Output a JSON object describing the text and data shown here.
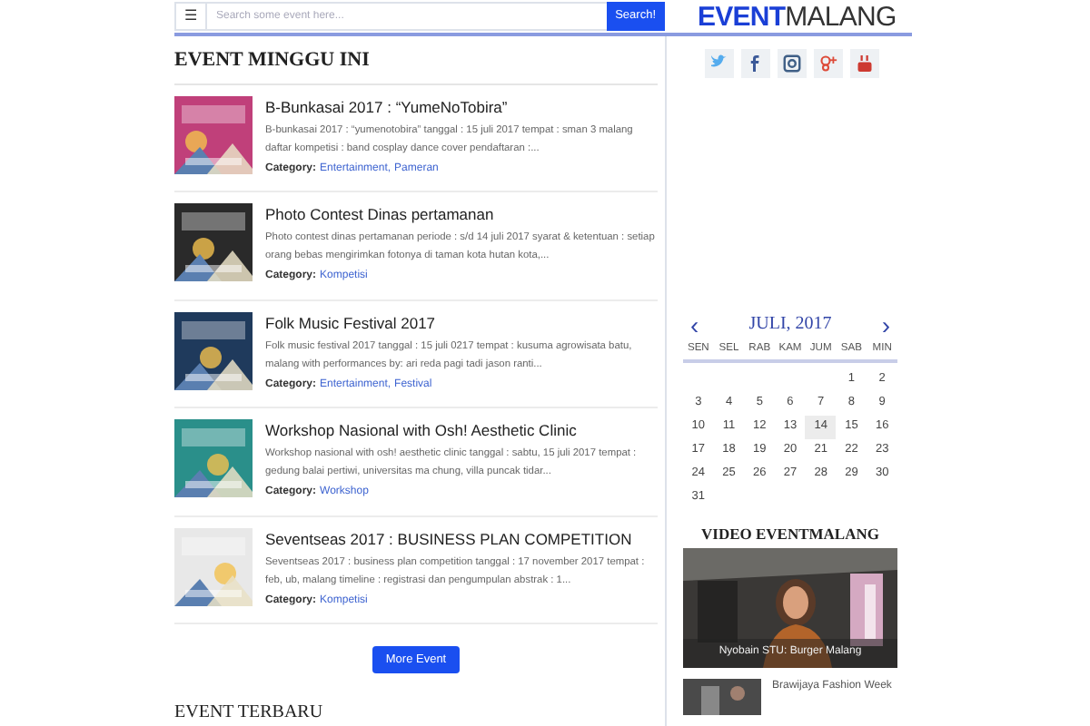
{
  "search": {
    "menu": "☰",
    "placeholder": "Search some event here...",
    "button": "Search!"
  },
  "logo": {
    "bold": "EVENT",
    "light": "MALANG"
  },
  "section_title": "EVENT MINGGU INI",
  "events": [
    {
      "title": "B-Bunkasai 2017 : “YumeNoTobira”",
      "description": "B-bunkasai 2017 : “yumenotobira” tanggal : 15 juli 2017 tempat : sman 3 malang daftar kompetisi : band cosplay dance cover pendaftaran :...",
      "category_label": "Category:",
      "categories": [
        "Entertainment",
        "Pameran"
      ],
      "separator": ","
    },
    {
      "title": "Photo Contest Dinas pertamanan",
      "description": "Photo contest dinas pertamanan periode : s/d 14 juli 2017 syarat & ketentuan : setiap orang bebas mengirimkan fotonya di taman kota hutan kota,...",
      "category_label": "Category:",
      "categories": [
        "Kompetisi"
      ]
    },
    {
      "title": "Folk Music Festival 2017",
      "description": "Folk music festival 2017 tanggal : 15 juli 0217 tempat  : kusuma agrowisata batu, malang   with performances by: ari reda pagi tadi jason ranti...",
      "category_label": "Category:",
      "categories": [
        "Entertainment",
        "Festival"
      ],
      "separator": ","
    },
    {
      "title": "Workshop Nasional with Osh! Aesthetic Clinic",
      "description": "Workshop nasional with osh! aesthetic clinic tanggal : sabtu, 15 juli 2017 tempat : gedung balai pertiwi, universitas ma chung, villa puncak tidar...",
      "category_label": "Category:",
      "categories": [
        "Workshop"
      ]
    },
    {
      "title": "Seventseas 2017 : BUSINESS PLAN COMPETITION",
      "description": "Seventseas 2017 : business plan competition tanggal : 17 november 2017 tempat : feb, ub, malang timeline : registrasi dan pengumpulan abstrak : 1...",
      "category_label": "Category:",
      "categories": [
        "Kompetisi"
      ]
    }
  ],
  "more_button": "More Event",
  "next_section_title": "EVENT TERBARU",
  "calendar": {
    "prev": "‹",
    "month": "JULI, 2017",
    "next": "›",
    "weekdays": [
      "SEN",
      "SEL",
      "RAB",
      "KAM",
      "JUM",
      "SAB",
      "MIN"
    ],
    "weeks": [
      [
        {
          "kind": "blank"
        },
        {
          "kind": "blank"
        },
        {
          "kind": "blank"
        },
        {
          "kind": "blank"
        },
        {
          "kind": "blank"
        },
        {
          "kind": "day",
          "day": "1",
          "selected": false
        },
        {
          "kind": "day",
          "day": "2",
          "selected": false
        }
      ],
      [
        {
          "day": "3",
          "selected": false
        },
        {
          "day": "4",
          "selected": false
        },
        {
          "day": "5",
          "selected": false
        },
        {
          "day": "6",
          "selected": false
        },
        {
          "day": "7",
          "selected": false
        },
        {
          "day": "8",
          "selected": false
        },
        {
          "day": "9",
          "selected": false
        }
      ],
      [
        {
          "day": "10",
          "selected": false
        },
        {
          "day": "11",
          "selected": false
        },
        {
          "day": "12",
          "selected": false
        },
        {
          "day": "13",
          "selected": false
        },
        {
          "day": "14",
          "selected": true
        },
        {
          "day": "15",
          "selected": false
        },
        {
          "day": "16",
          "selected": false
        }
      ],
      [
        {
          "day": "17",
          "selected": false
        },
        {
          "day": "18",
          "selected": false
        },
        {
          "day": "19",
          "selected": false
        },
        {
          "day": "20",
          "selected": false
        },
        {
          "day": "21",
          "selected": false
        },
        {
          "day": "22",
          "selected": false
        },
        {
          "day": "23",
          "selected": false
        }
      ],
      [
        {
          "day": "24",
          "selected": false
        },
        {
          "day": "25",
          "selected": false
        },
        {
          "day": "26",
          "selected": false
        },
        {
          "day": "27",
          "selected": false
        },
        {
          "day": "28",
          "selected": false
        },
        {
          "day": "29",
          "selected": false
        },
        {
          "day": "30",
          "selected": false
        }
      ],
      [
        {
          "day": "31",
          "selected": false
        }
      ]
    ]
  },
  "video": {
    "title": "VIDEO EVENTMALANG",
    "caption": "Nyobain STU: Burger Malang",
    "next_item": "Brawijaya Fashion Week"
  }
}
